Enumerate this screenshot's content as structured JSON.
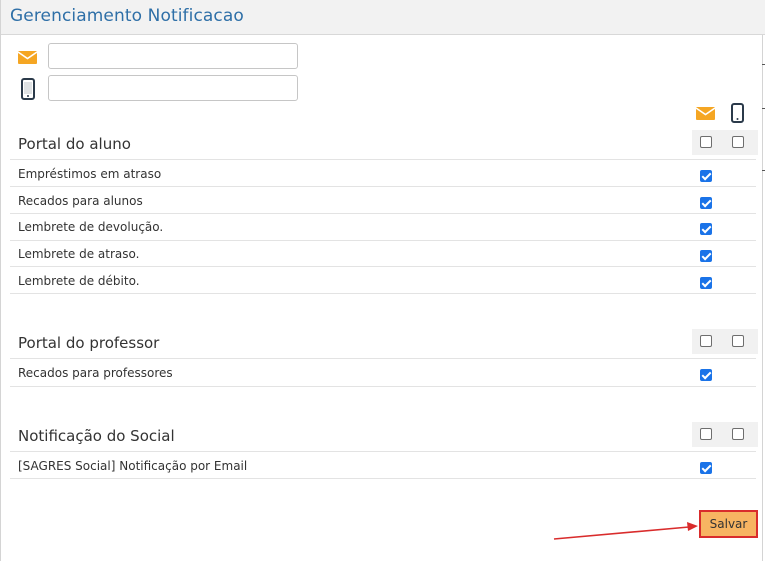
{
  "window": {
    "title": "Gerenciamento Notificacao"
  },
  "contacts": {
    "email": {
      "icon": "envelope-icon",
      "value": "",
      "placeholder": ""
    },
    "phone": {
      "icon": "mobile-phone-icon",
      "value": "",
      "placeholder": ""
    }
  },
  "columns": [
    {
      "icon": "envelope-icon",
      "color": "#f5a623"
    },
    {
      "icon": "mobile-phone-icon",
      "color": "#2b3a4a"
    }
  ],
  "sections": [
    {
      "title": "Portal do aluno",
      "header_checks": [
        false,
        false
      ],
      "items": [
        {
          "label": "Empréstimos em atraso",
          "email": true
        },
        {
          "label": "Recados para alunos",
          "email": true
        },
        {
          "label": "Lembrete de devolução.",
          "email": true
        },
        {
          "label": "Lembrete de atraso.",
          "email": true
        },
        {
          "label": "Lembrete de débito.",
          "email": true
        }
      ]
    },
    {
      "title": "Portal do professor",
      "header_checks": [
        false,
        false
      ],
      "items": [
        {
          "label": "Recados para professores",
          "email": true
        }
      ]
    },
    {
      "title": "Notificação do Social",
      "header_checks": [
        false,
        false
      ],
      "items": [
        {
          "label": "[SAGRES Social] Notificação por Email",
          "email": true
        }
      ]
    }
  ],
  "actions": {
    "save_label": "Salvar"
  },
  "colors": {
    "title": "#2e6fa7",
    "accent_orange": "#f5a623",
    "save_bg": "#f7b462",
    "highlight_red": "#d92c2c",
    "check_blue": "#1a73e8"
  }
}
